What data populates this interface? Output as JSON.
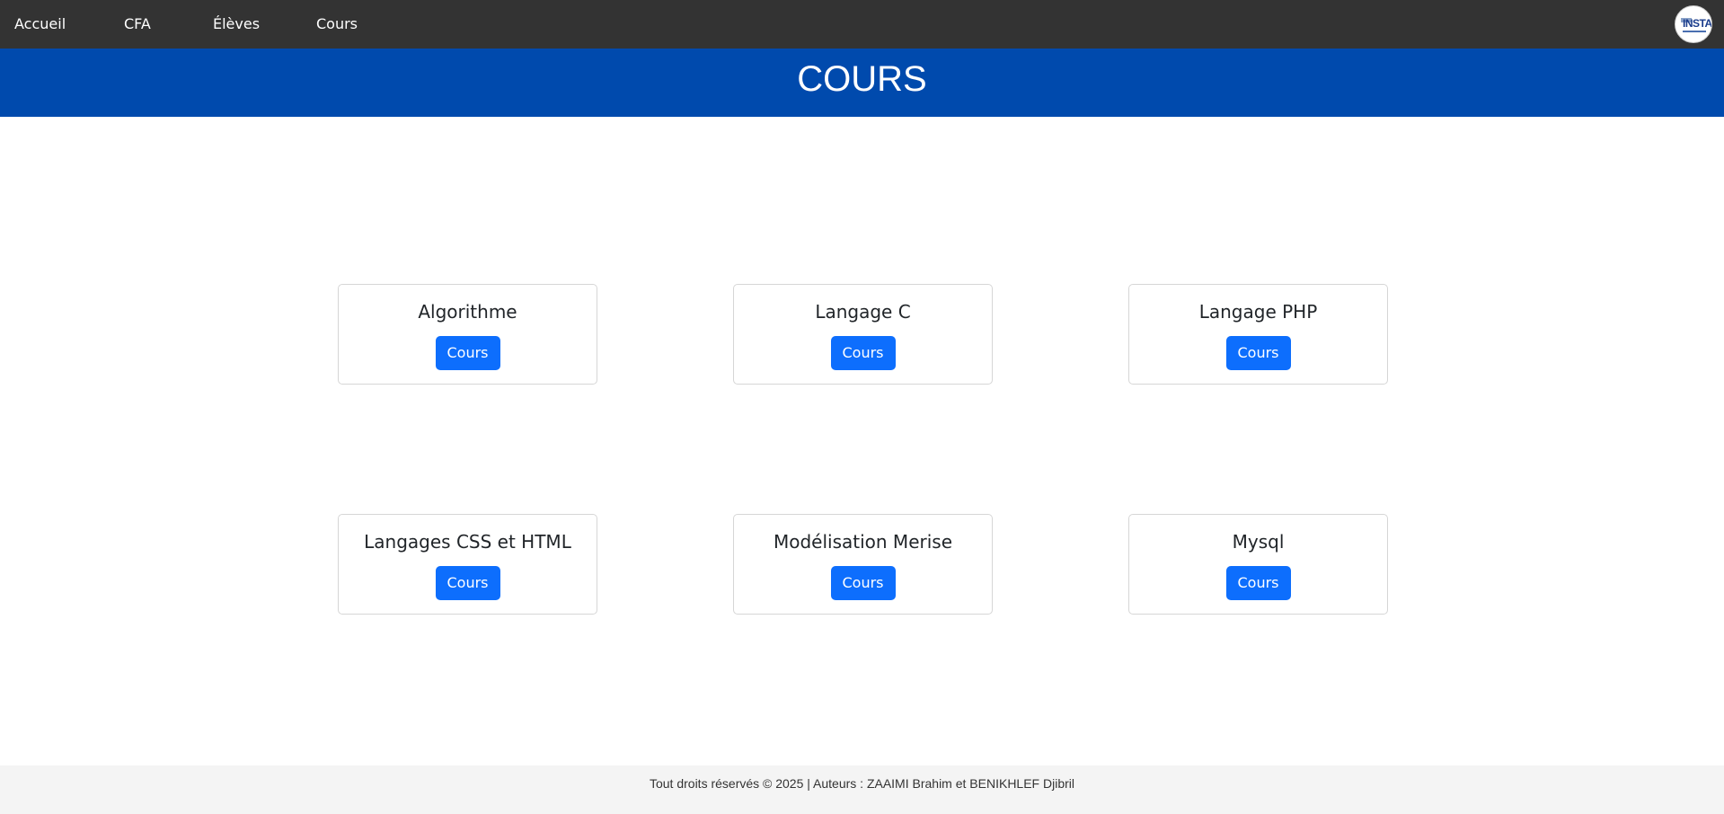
{
  "nav": {
    "items": [
      {
        "label": "Accueil"
      },
      {
        "label": "CFA"
      },
      {
        "label": "Élèves"
      },
      {
        "label": "Cours"
      }
    ],
    "logo_text": "INSTA"
  },
  "header": {
    "title": "COURS"
  },
  "cards": [
    {
      "title": "Algorithme",
      "button": "Cours"
    },
    {
      "title": "Langage C",
      "button": "Cours"
    },
    {
      "title": "Langage PHP",
      "button": "Cours"
    },
    {
      "title": "Langages CSS et HTML",
      "button": "Cours"
    },
    {
      "title": "Modélisation Merise",
      "button": "Cours"
    },
    {
      "title": "Mysql",
      "button": "Cours"
    }
  ],
  "footer": {
    "text": "Tout droits réservés © 2025 | Auteurs : ZAAIMI Brahim et BENIKHLEF Djibril"
  },
  "colors": {
    "nav_bg": "#333333",
    "header_bg": "#004aad",
    "button_bg": "#0d6efd",
    "footer_bg": "#f4f4f4"
  }
}
